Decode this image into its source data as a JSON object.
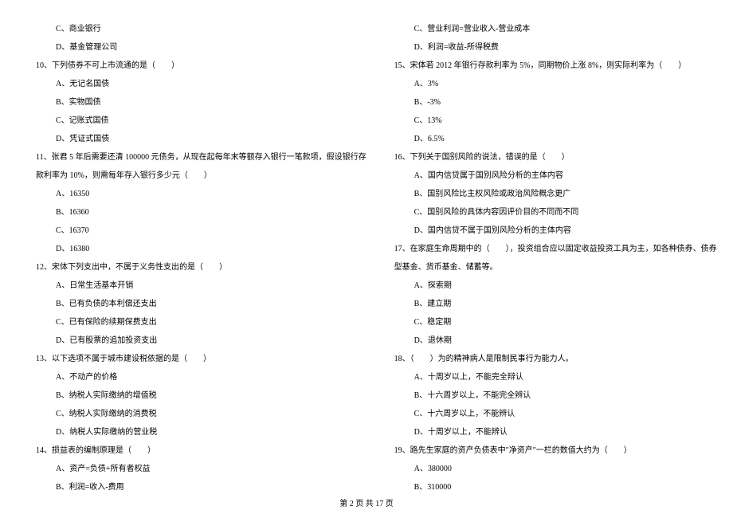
{
  "left_column": [
    {
      "text": "C、商业银行",
      "indent": "indent-1"
    },
    {
      "text": "D、基金管理公司",
      "indent": "indent-1"
    },
    {
      "text": "10、下列债券不可上市流通的是（　　）",
      "indent": "indent-q"
    },
    {
      "text": "A、无记名国债",
      "indent": "indent-1"
    },
    {
      "text": "B、实物国债",
      "indent": "indent-1"
    },
    {
      "text": "C、记账式国债",
      "indent": "indent-1"
    },
    {
      "text": "D、凭证式国债",
      "indent": "indent-1"
    },
    {
      "text": "11、张君 5 年后需要还清 100000 元债务，从现在起每年末等额存入银行一笔款项，假设银行存",
      "indent": "indent-q"
    },
    {
      "text": "款利率为 10%，则需每年存入银行多少元（　　）",
      "indent": "indent-q"
    },
    {
      "text": "A、16350",
      "indent": "indent-1"
    },
    {
      "text": "B、16360",
      "indent": "indent-1"
    },
    {
      "text": "C、16370",
      "indent": "indent-1"
    },
    {
      "text": "D、16380",
      "indent": "indent-1"
    },
    {
      "text": "12、宋体下列支出中，不属于义务性支出的是（　　）",
      "indent": "indent-q"
    },
    {
      "text": "A、日常生活基本开销",
      "indent": "indent-1"
    },
    {
      "text": "B、已有负债的本利偿还支出",
      "indent": "indent-1"
    },
    {
      "text": "C、已有保险的续期保费支出",
      "indent": "indent-1"
    },
    {
      "text": "D、已有股票的追加投资支出",
      "indent": "indent-1"
    },
    {
      "text": "13、以下选项不属于城市建设税依据的是（　　）",
      "indent": "indent-q"
    },
    {
      "text": "A、不动产的价格",
      "indent": "indent-1"
    },
    {
      "text": "B、纳税人实际缴纳的增值税",
      "indent": "indent-1"
    },
    {
      "text": "C、纳税人实际缴纳的消费税",
      "indent": "indent-1"
    },
    {
      "text": "D、纳税人实际缴纳的营业税",
      "indent": "indent-1"
    },
    {
      "text": "14、损益表的编制原理是（　　）",
      "indent": "indent-q"
    },
    {
      "text": "A、资产=负债+所有者权益",
      "indent": "indent-1"
    },
    {
      "text": "B、利润=收入-费用",
      "indent": "indent-1"
    }
  ],
  "right_column": [
    {
      "text": "C、营业利润=营业收入-营业成本",
      "indent": "indent-1"
    },
    {
      "text": "D、利润=收益-所得税费",
      "indent": "indent-1"
    },
    {
      "text": "15、宋体若 2012 年银行存款利率为 5%，同期物价上涨 8%，则实际利率为（　　）",
      "indent": "indent-q"
    },
    {
      "text": "A、3%",
      "indent": "indent-1"
    },
    {
      "text": "B、-3%",
      "indent": "indent-1"
    },
    {
      "text": "C、13%",
      "indent": "indent-1"
    },
    {
      "text": "D、6.5%",
      "indent": "indent-1"
    },
    {
      "text": "16、下列关于国别风险的说法，错误的是（　　）",
      "indent": "indent-q"
    },
    {
      "text": "A、国内信贷属于国别风险分析的主体内容",
      "indent": "indent-1"
    },
    {
      "text": "B、国别风险比主权风险或政治风险概念更广",
      "indent": "indent-1"
    },
    {
      "text": "C、国别风险的具体内容因评价目的不同而不同",
      "indent": "indent-1"
    },
    {
      "text": "D、国内信贷不属于国别风险分析的主体内容",
      "indent": "indent-1"
    },
    {
      "text": "17、在家庭生命周期中的（　　），投资组合应以固定收益投资工具为主，如各种债券、债券",
      "indent": "indent-q"
    },
    {
      "text": "型基金、货币基金、储蓄等。",
      "indent": "indent-q"
    },
    {
      "text": "A、探索期",
      "indent": "indent-1"
    },
    {
      "text": "B、建立期",
      "indent": "indent-1"
    },
    {
      "text": "C、稳定期",
      "indent": "indent-1"
    },
    {
      "text": "D、退休期",
      "indent": "indent-1"
    },
    {
      "text": "18、（　　）为的精神病人是限制民事行为能力人。",
      "indent": "indent-q"
    },
    {
      "text": "A、十周岁以上，不能完全辩认",
      "indent": "indent-1"
    },
    {
      "text": "B、十六周岁以上，不能完全辨认",
      "indent": "indent-1"
    },
    {
      "text": "C、十六周岁以上，不能辨认",
      "indent": "indent-1"
    },
    {
      "text": "D、十周岁以上，不能辨认",
      "indent": "indent-1"
    },
    {
      "text": "19、路先生家庭的资产负债表中\"净资产\"一栏的数值大约为（　　）",
      "indent": "indent-q"
    },
    {
      "text": "A、380000",
      "indent": "indent-1"
    },
    {
      "text": "B、310000",
      "indent": "indent-1"
    }
  ],
  "footer": "第 2 页 共 17 页"
}
